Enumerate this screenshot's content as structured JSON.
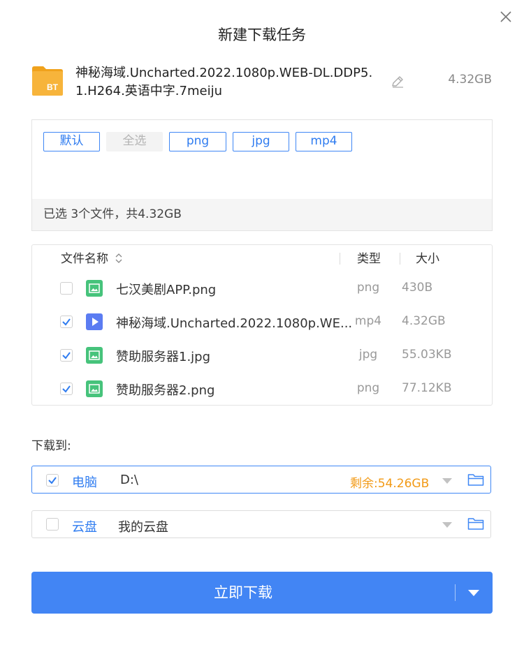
{
  "dialog": {
    "title": "新建下载任务"
  },
  "task": {
    "name": "神秘海域.Uncharted.2022.1080p.WEB-DL.DDP5.1.H264.英语中字.7meiju",
    "size": "4.32GB",
    "icon": "bt-folder-icon",
    "icon_label": "BT"
  },
  "filters": {
    "chips": [
      {
        "label": "默认",
        "active": true
      },
      {
        "label": "全选",
        "active": false
      },
      {
        "label": "png",
        "active": true
      },
      {
        "label": "jpg",
        "active": true
      },
      {
        "label": "mp4",
        "active": true
      }
    ],
    "summary": "已选 3个文件，共4.32GB"
  },
  "file_list": {
    "columns": {
      "name": "文件名称",
      "type": "类型",
      "size": "大小"
    },
    "rows": [
      {
        "name": "七汉美剧APP.png",
        "type": "png",
        "size": "430B",
        "checked": false,
        "icon": "image-file-icon"
      },
      {
        "name": "神秘海域.Uncharted.2022.1080p.WE...",
        "type": "mp4",
        "size": "4.32GB",
        "checked": true,
        "icon": "video-file-icon"
      },
      {
        "name": "赞助服务器1.jpg",
        "type": "jpg",
        "size": "55.03KB",
        "checked": true,
        "icon": "image-file-icon"
      },
      {
        "name": "赞助服务器2.png",
        "type": "png",
        "size": "77.12KB",
        "checked": true,
        "icon": "image-file-icon"
      }
    ]
  },
  "download_to": {
    "label": "下载到:",
    "options": [
      {
        "label": "电脑",
        "path": "D:\\",
        "free": "剩余:54.26GB",
        "checked": true
      },
      {
        "label": "云盘",
        "path": "我的云盘",
        "free": "",
        "checked": false
      }
    ]
  },
  "primary_button": {
    "label": "立即下载"
  },
  "colors": {
    "accent": "#4285f4",
    "link": "#2f7cf0",
    "warning": "#f29a16",
    "image_icon": "#46c37b",
    "video_icon": "#5b7cf2"
  }
}
